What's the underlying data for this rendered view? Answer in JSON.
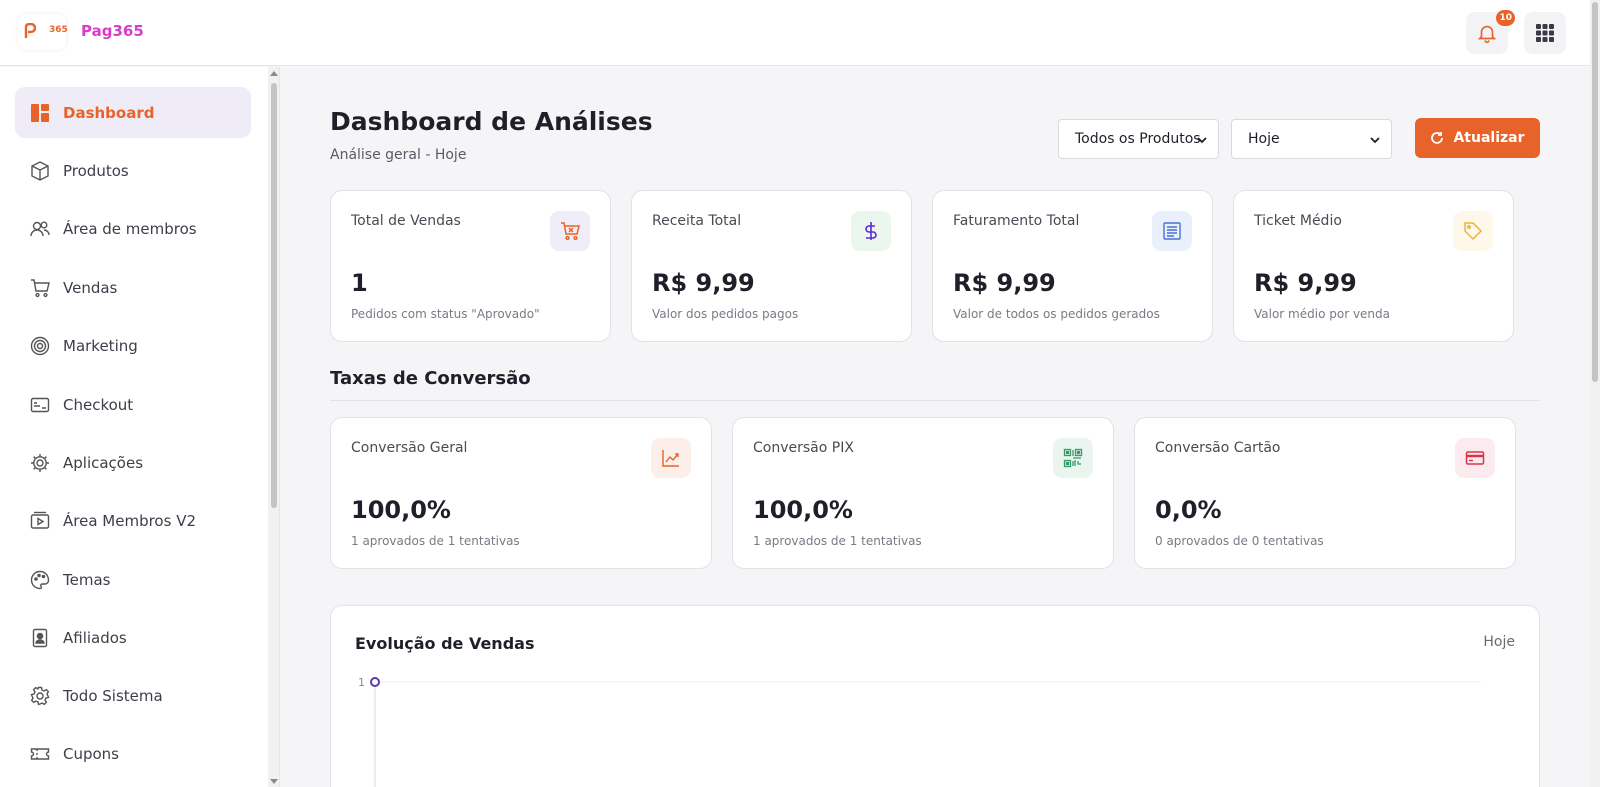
{
  "app": {
    "brand": "Pag365",
    "logo_text": "365",
    "notifications_count": "10",
    "colors": {
      "accent": "#e8632a",
      "brand": "#d93cc9",
      "active_bg": "#efebf7"
    }
  },
  "sidebar": {
    "items": [
      {
        "label": "Dashboard",
        "icon": "dashboard-icon",
        "active": true
      },
      {
        "label": "Produtos",
        "icon": "box-icon"
      },
      {
        "label": "Área de membros",
        "icon": "users-icon"
      },
      {
        "label": "Vendas",
        "icon": "cart-icon"
      },
      {
        "label": "Marketing",
        "icon": "target-icon"
      },
      {
        "label": "Checkout",
        "icon": "checkout-icon"
      },
      {
        "label": "Aplicações",
        "icon": "gear-icon"
      },
      {
        "label": "Área Membros V2",
        "icon": "video-icon"
      },
      {
        "label": "Temas",
        "icon": "palette-icon"
      },
      {
        "label": "Afiliados",
        "icon": "id-badge-icon"
      },
      {
        "label": "Todo Sistema",
        "icon": "settings-icon"
      },
      {
        "label": "Cupons",
        "icon": "ticket-icon"
      }
    ]
  },
  "header": {
    "title": "Dashboard de Análises",
    "subtitle": "Análise geral - Hoje",
    "product_filter": "Todos os Produtos",
    "date_filter": "Hoje",
    "refresh_label": "Atualizar"
  },
  "stats": [
    {
      "title": "Total de Vendas",
      "value": "1",
      "desc": "Pedidos com status \"Aprovado\"",
      "icon": "cart-icon",
      "color": "#e8632a",
      "bg": "#f1edf8"
    },
    {
      "title": "Receita Total",
      "value": "R$ 9,99",
      "desc": "Valor dos pedidos pagos",
      "icon": "dollar-icon",
      "color": "#5a2bd9",
      "bg": "#eaf6ee"
    },
    {
      "title": "Faturamento Total",
      "value": "R$ 9,99",
      "desc": "Valor de todos os pedidos gerados",
      "icon": "receipt-icon",
      "color": "#4a6fd9",
      "bg": "#eaf0fb"
    },
    {
      "title": "Ticket Médio",
      "value": "R$ 9,99",
      "desc": "Valor médio por venda",
      "icon": "tag-icon",
      "color": "#e8b43a",
      "bg": "#fdf8ea"
    }
  ],
  "conversion": {
    "section_title": "Taxas de Conversão",
    "cards": [
      {
        "title": "Conversão Geral",
        "value": "100,0%",
        "desc": "1 aprovados de 1 tentativas",
        "icon": "trend-icon",
        "color": "#e8632a",
        "bg": "#fcefe9"
      },
      {
        "title": "Conversão PIX",
        "value": "100,0%",
        "desc": "1 aprovados de 1 tentativas",
        "icon": "qr-icon",
        "color": "#3a9a6a",
        "bg": "#eaf5ef"
      },
      {
        "title": "Conversão Cartão",
        "value": "0,0%",
        "desc": "0 aprovados de 0 tentativas",
        "icon": "card-icon",
        "color": "#d9344a",
        "bg": "#fcebee"
      }
    ]
  },
  "sales_chart": {
    "title": "Evolução de Vendas",
    "period": "Hoje"
  },
  "chart_data": {
    "type": "line",
    "title": "Evolução de Vendas",
    "xlabel": "",
    "ylabel": "",
    "y_ticks": [
      "1"
    ],
    "series": [
      {
        "values": [
          1
        ]
      }
    ],
    "color": "#5a3bb0"
  }
}
